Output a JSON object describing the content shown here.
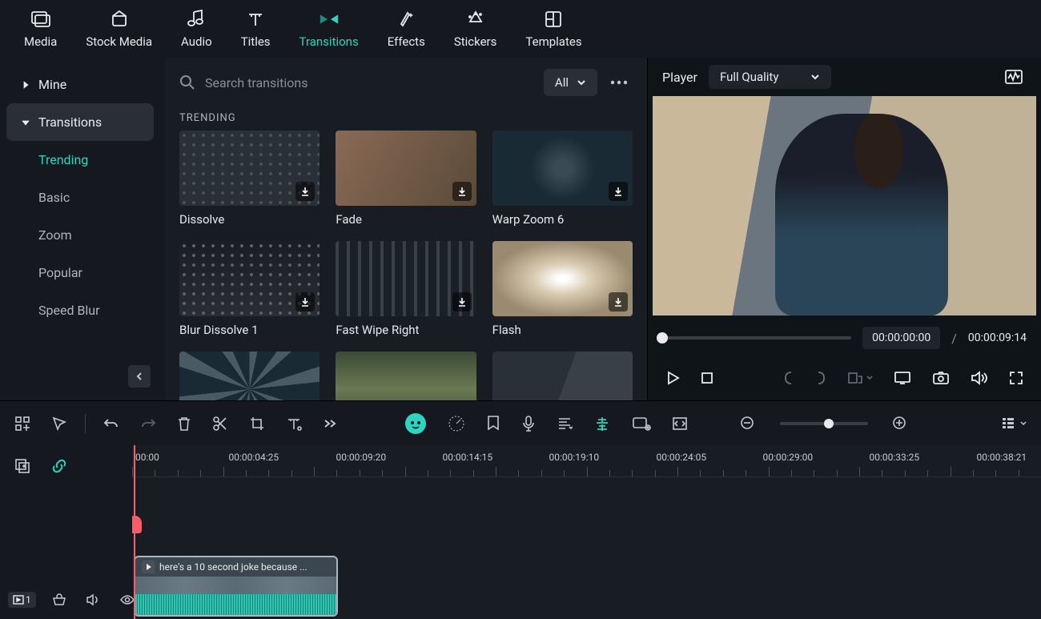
{
  "nav": {
    "tabs": [
      {
        "label": "Media",
        "icon": "media-icon"
      },
      {
        "label": "Stock Media",
        "icon": "stock-media-icon"
      },
      {
        "label": "Audio",
        "icon": "audio-icon"
      },
      {
        "label": "Titles",
        "icon": "titles-icon"
      },
      {
        "label": "Transitions",
        "icon": "transitions-icon",
        "active": true
      },
      {
        "label": "Effects",
        "icon": "effects-icon"
      },
      {
        "label": "Stickers",
        "icon": "stickers-icon"
      },
      {
        "label": "Templates",
        "icon": "templates-icon"
      }
    ]
  },
  "sidebar": {
    "mine_label": "Mine",
    "transitions_label": "Transitions",
    "categories": [
      {
        "label": "Trending",
        "active": true
      },
      {
        "label": "Basic"
      },
      {
        "label": "Zoom"
      },
      {
        "label": "Popular"
      },
      {
        "label": "Speed Blur"
      }
    ]
  },
  "browser": {
    "search_placeholder": "Search transitions",
    "filter_label": "All",
    "section_title": "TRENDING",
    "items": [
      {
        "label": "Dissolve"
      },
      {
        "label": "Fade"
      },
      {
        "label": "Warp Zoom 6"
      },
      {
        "label": "Blur Dissolve 1"
      },
      {
        "label": "Fast Wipe Right"
      },
      {
        "label": "Flash"
      },
      {
        "label": ""
      },
      {
        "label": ""
      },
      {
        "label": ""
      }
    ]
  },
  "player": {
    "label": "Player",
    "quality": "Full Quality",
    "current_time": "00:00:00:00",
    "separator": "/",
    "total_time": "00:00:09:14"
  },
  "timeline": {
    "ruler": [
      "00:00",
      "00:00:04:25",
      "00:00:09:20",
      "00:00:14:15",
      "00:00:19:10",
      "00:00:24:05",
      "00:00:29:00",
      "00:00:33:25",
      "00:00:38:21"
    ],
    "clip_title": "here's a 10 second joke because ...",
    "track_number": "1"
  }
}
